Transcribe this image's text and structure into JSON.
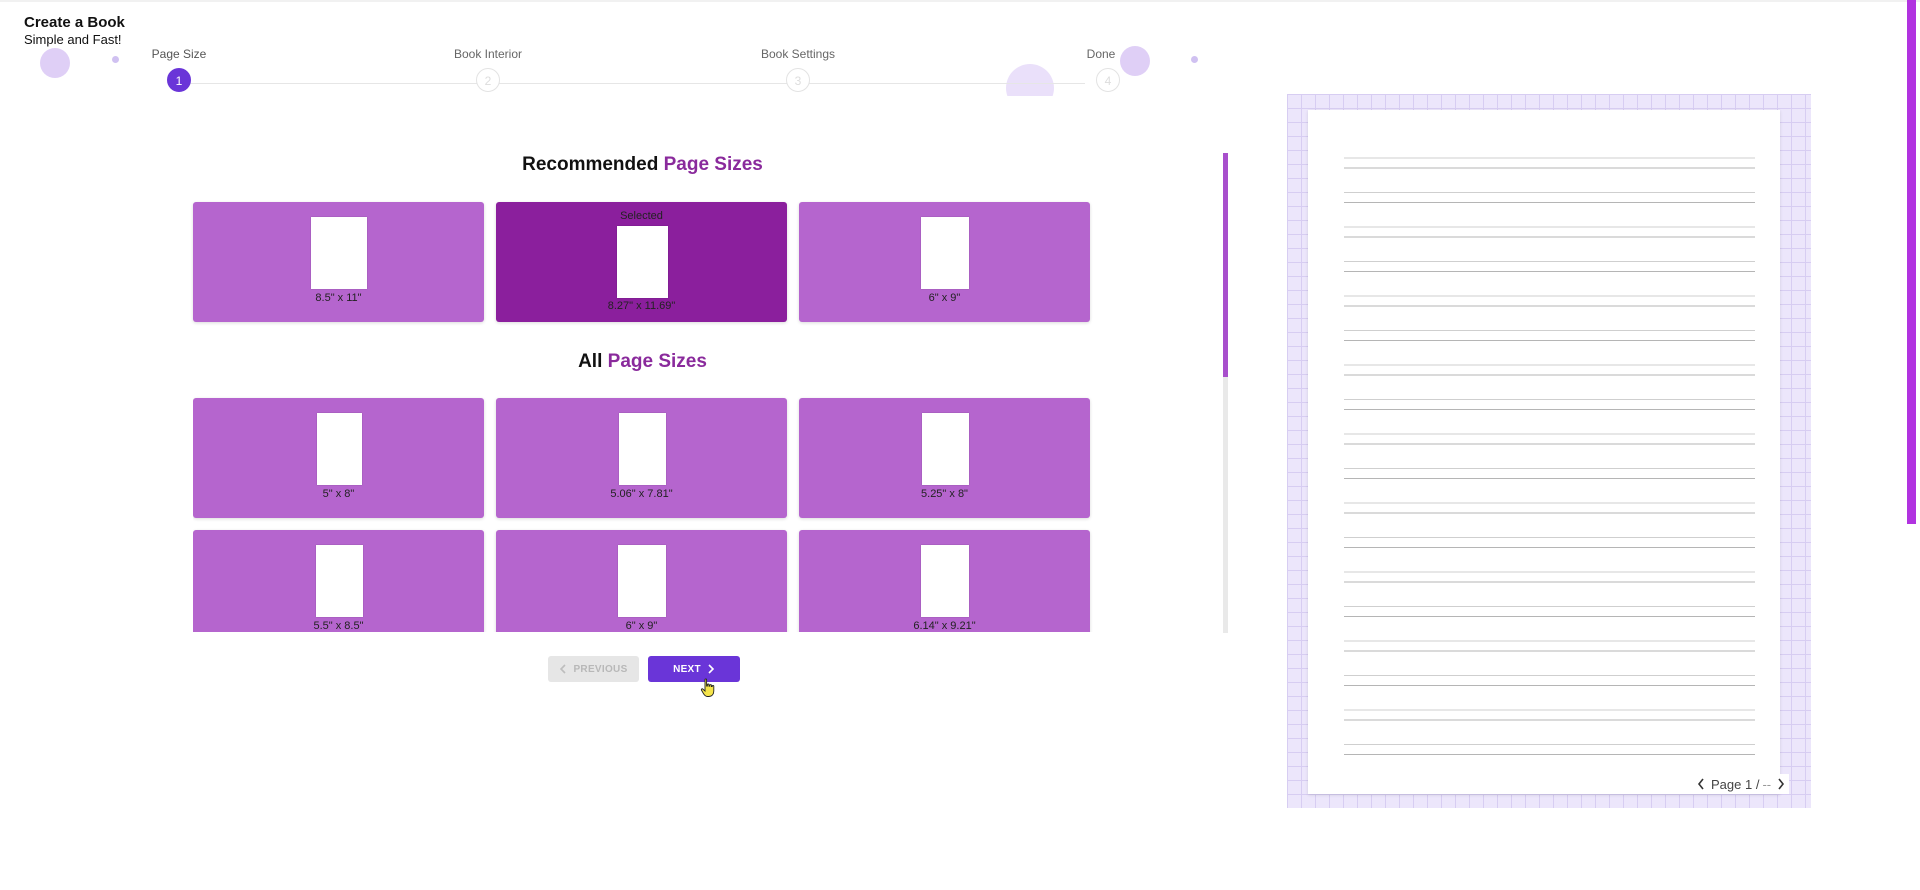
{
  "app": {
    "title": "Create a Book",
    "subtitle": "Simple and Fast!"
  },
  "stepper": {
    "steps": [
      {
        "label": "Page Size",
        "number": "1",
        "active": true
      },
      {
        "label": "Book Interior",
        "number": "2",
        "active": false
      },
      {
        "label": "Book Settings",
        "number": "3",
        "active": false
      },
      {
        "label": "Done",
        "number": "4",
        "active": false
      }
    ]
  },
  "recommended": {
    "title_plain": "Recommended",
    "title_accent": "Page Sizes",
    "sizes": [
      {
        "label": "8.5\" x 11\"",
        "selected": false
      },
      {
        "label": "8.27\" x 11.69\"",
        "selected": true,
        "selected_text": "Selected"
      },
      {
        "label": "6\" x 9\"",
        "selected": false
      }
    ]
  },
  "all_sizes": {
    "title_plain": "All",
    "title_accent": "Page Sizes",
    "sizes": [
      {
        "label": "5\" x 8\""
      },
      {
        "label": "5.06\" x 7.81\""
      },
      {
        "label": "5.25\" x 8\""
      },
      {
        "label": "5.5\" x 8.5\""
      },
      {
        "label": "6\" x 9\""
      },
      {
        "label": "6.14\" x 9.21\""
      }
    ]
  },
  "buttons": {
    "previous": "PREVIOUS",
    "next": "NEXT"
  },
  "preview": {
    "page_indicator": "Page 1 /",
    "page_total": "--"
  },
  "colors": {
    "accent": "#6a35d8",
    "card": "#b565ce",
    "card_selected": "#8b1f9d",
    "title_accent": "#8a2a9c"
  },
  "icons": {
    "previous": "chevron-left-icon",
    "next": "chevron-right-icon",
    "cursor": "hand-pointer-icon"
  }
}
